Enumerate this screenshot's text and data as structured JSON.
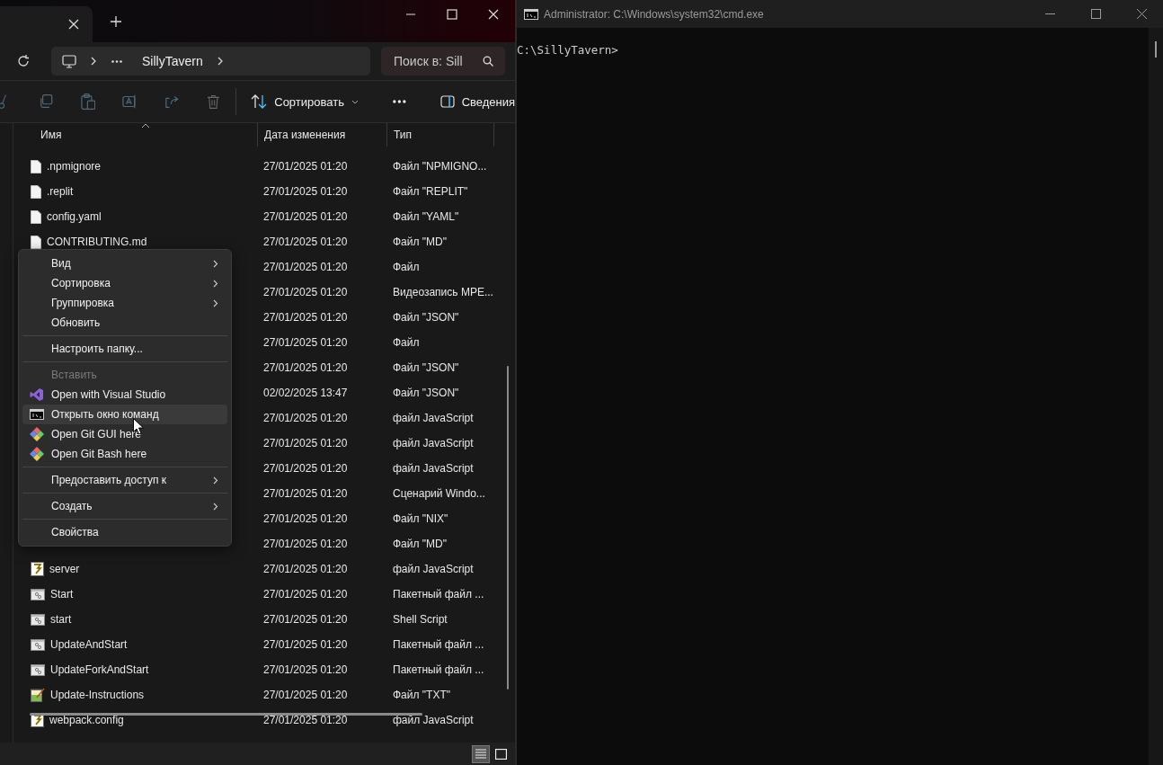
{
  "explorer": {
    "address": {
      "folder": "SillyTavern"
    },
    "search": {
      "placeholder": "Поиск в: Sill"
    },
    "toolbar": {
      "sort_label": "Сортировать",
      "details_label": "Сведения"
    },
    "columns": [
      "Имя",
      "Дата изменения",
      "Тип"
    ],
    "rows": [
      {
        "kind": "blank",
        "name": ".npmignore",
        "date": "27/01/2025 01:20",
        "type": "Файл \"NPMIGNO..."
      },
      {
        "kind": "blank",
        "name": ".replit",
        "date": "27/01/2025 01:20",
        "type": "Файл \"REPLIT\""
      },
      {
        "kind": "blank",
        "name": "config.yaml",
        "date": "27/01/2025 01:20",
        "type": "Файл \"YAML\""
      },
      {
        "kind": "blank",
        "name": "CONTRIBUTING.md",
        "date": "27/01/2025 01:20",
        "type": "Файл \"MD\""
      },
      {
        "kind": "hidden",
        "date": "27/01/2025 01:20",
        "type": "Файл"
      },
      {
        "kind": "hidden",
        "date": "27/01/2025 01:20",
        "type": "Видеозапись MPE..."
      },
      {
        "kind": "hidden",
        "date": "27/01/2025 01:20",
        "type": "Файл \"JSON\""
      },
      {
        "kind": "hidden",
        "date": "27/01/2025 01:20",
        "type": "Файл"
      },
      {
        "kind": "hidden",
        "date": "27/01/2025 01:20",
        "type": "Файл \"JSON\""
      },
      {
        "kind": "hidden",
        "date": "02/02/2025 13:47",
        "type": "Файл \"JSON\""
      },
      {
        "kind": "hidden",
        "date": "27/01/2025 01:20",
        "type": "файл JavaScript"
      },
      {
        "kind": "hidden",
        "date": "27/01/2025 01:20",
        "type": "файл JavaScript"
      },
      {
        "kind": "hidden",
        "date": "27/01/2025 01:20",
        "type": "файл JavaScript"
      },
      {
        "kind": "hidden",
        "date": "27/01/2025 01:20",
        "type": "Сценарий Windo..."
      },
      {
        "kind": "hidden",
        "date": "27/01/2025 01:20",
        "type": "Файл \"NIX\""
      },
      {
        "kind": "hidden",
        "date": "27/01/2025 01:20",
        "type": "Файл \"MD\""
      },
      {
        "kind": "js",
        "name": "server",
        "date": "27/01/2025 01:20",
        "type": "файл JavaScript"
      },
      {
        "kind": "bat",
        "name": "Start",
        "date": "27/01/2025 01:20",
        "type": "Пакетный файл ..."
      },
      {
        "kind": "bat",
        "name": "start",
        "date": "27/01/2025 01:20",
        "type": "Shell Script"
      },
      {
        "kind": "bat",
        "name": "UpdateAndStart",
        "date": "27/01/2025 01:20",
        "type": "Пакетный файл ..."
      },
      {
        "kind": "bat",
        "name": "UpdateForkAndStart",
        "date": "27/01/2025 01:20",
        "type": "Пакетный файл ..."
      },
      {
        "kind": "txt",
        "name": "Update-Instructions",
        "date": "27/01/2025 01:20",
        "type": "Файл \"TXT\""
      },
      {
        "kind": "js",
        "name": "webpack.config",
        "date": "27/01/2025 01:20",
        "type": "файл JavaScript"
      }
    ],
    "context_menu": [
      {
        "kind": "text",
        "label": "Вид",
        "submenu": true,
        "disabled": false,
        "selected": false
      },
      {
        "kind": "text",
        "label": "Сортировка",
        "submenu": true,
        "disabled": false,
        "selected": false
      },
      {
        "kind": "text",
        "label": "Группировка",
        "submenu": true,
        "disabled": false,
        "selected": false
      },
      {
        "kind": "text",
        "label": "Обновить",
        "submenu": false,
        "disabled": false,
        "selected": false
      },
      {
        "kind": "separator"
      },
      {
        "kind": "text",
        "label": "Настроить папку...",
        "submenu": false,
        "disabled": false,
        "selected": false
      },
      {
        "kind": "separator"
      },
      {
        "kind": "text",
        "label": "Вставить",
        "submenu": false,
        "disabled": true,
        "selected": false
      },
      {
        "kind": "vs",
        "label": "Open with Visual Studio",
        "submenu": false,
        "disabled": false,
        "selected": false
      },
      {
        "kind": "cmd",
        "label": "Открыть окно команд",
        "submenu": false,
        "disabled": false,
        "selected": true
      },
      {
        "kind": "git",
        "label": "Open Git GUI here",
        "submenu": false,
        "disabled": false,
        "selected": false
      },
      {
        "kind": "git",
        "label": "Open Git Bash here",
        "submenu": false,
        "disabled": false,
        "selected": false
      },
      {
        "kind": "separator"
      },
      {
        "kind": "text",
        "label": "Предоставить доступ к",
        "submenu": true,
        "disabled": false,
        "selected": false
      },
      {
        "kind": "separator"
      },
      {
        "kind": "text",
        "label": "Создать",
        "submenu": true,
        "disabled": false,
        "selected": false
      },
      {
        "kind": "separator"
      },
      {
        "kind": "text",
        "label": "Свойства",
        "submenu": false,
        "disabled": false,
        "selected": false
      }
    ],
    "view_buttons": [
      {
        "selected": true
      },
      {
        "selected": false
      }
    ]
  },
  "console": {
    "title": "Administrator: C:\\Windows\\system32\\cmd.exe",
    "prompt": "C:\\SillyTavern>"
  }
}
